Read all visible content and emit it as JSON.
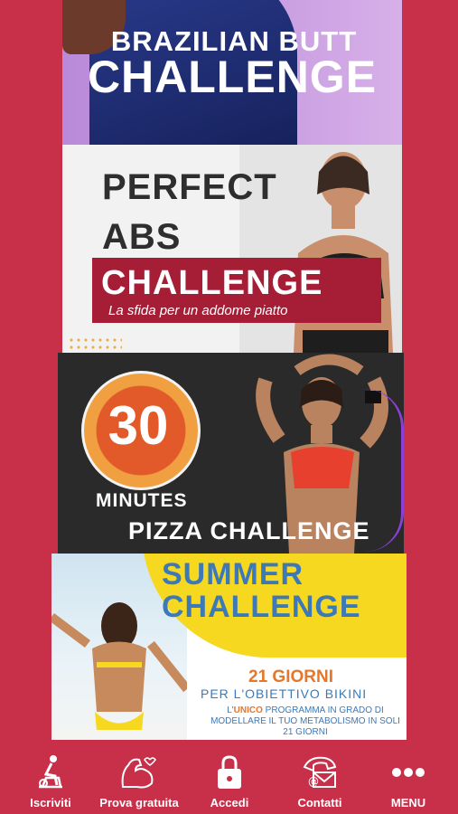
{
  "cards": [
    {
      "line1": "BRAZILIAN BUTT",
      "line2": "CHALLENGE"
    },
    {
      "line1": "PERFECT",
      "line2": "ABS",
      "line3": "CHALLENGE",
      "subtitle": "La sfida per un addome piatto"
    },
    {
      "number": "30",
      "line1": "MINUTES",
      "line2": "PIZZA CHALLENGE"
    },
    {
      "line1": "SUMMER",
      "line2": "CHALLENGE",
      "line3": "21 GIORNI",
      "line4": "PER L'OBIETTIVO BIKINI",
      "desc_pre": "L'",
      "desc_highlight": "UNICO",
      "desc_post": " PROGRAMMA IN GRADO DI MODELLARE IL TUO METABOLISMO IN SOLI 21 GIORNI"
    }
  ],
  "nav": {
    "items": [
      {
        "label": "Iscriviti",
        "icon": "exercise-bike-icon"
      },
      {
        "label": "Prova gratuita",
        "icon": "flexed-arm-icon"
      },
      {
        "label": "Accedi",
        "icon": "lock-icon"
      },
      {
        "label": "Contatti",
        "icon": "phone-mail-icon"
      },
      {
        "label": "MENU",
        "icon": "more-dots-icon"
      }
    ]
  },
  "colors": {
    "background": "#c8304a",
    "accent_dark": "#a61e36",
    "summer_blue": "#3c79b8",
    "summer_yellow": "#f7d820"
  }
}
